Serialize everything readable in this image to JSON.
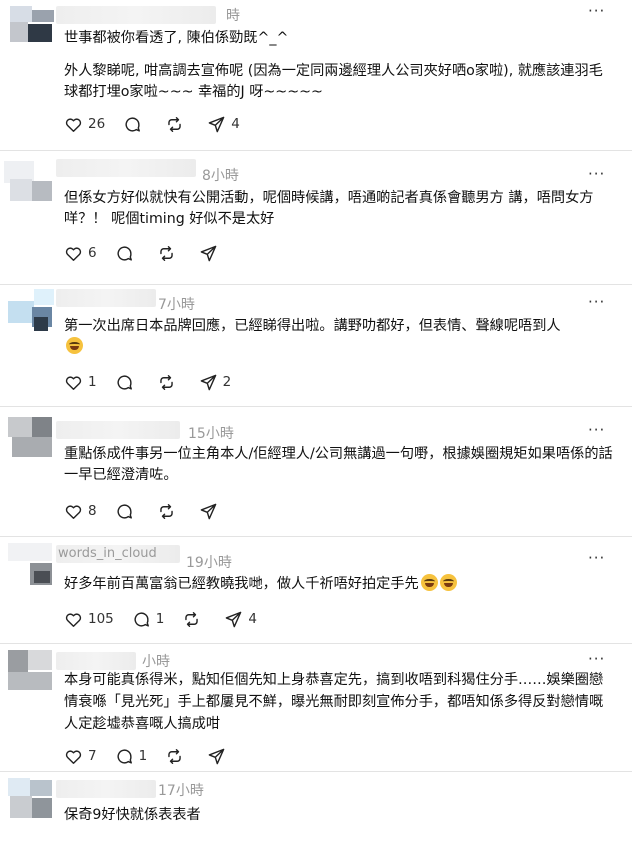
{
  "posts": [
    {
      "time": "時",
      "paragraphs": [
        "世事都被你看透了, 陳伯係勁既^_^",
        "外人黎睇呢, 咁高調去宣佈呢 (因為一定同兩邊經理人公司夾好哂o家啦), 就應該連羽毛球都打埋o家啦~~~ 幸福的J 呀~~~~~"
      ],
      "likes": "26",
      "comments": "",
      "reposts": "",
      "shares": "4"
    },
    {
      "time": "8小時",
      "paragraphs": [
        "但係女方好似就快有公開活動，呢個時候講，唔通啲記者真係會聽男方 講，唔問女方咩？！ 呢個timing 好似不是太好"
      ],
      "likes": "6",
      "comments": "",
      "reposts": "",
      "shares": ""
    },
    {
      "time": "7小時",
      "paragraphs": [
        "第一次出席日本品牌回應，已經睇得出啦。講野叻都好，但表情、聲線呢唔到人"
      ],
      "likes": "1",
      "comments": "",
      "reposts": "",
      "shares": "2"
    },
    {
      "time": "15小時",
      "paragraphs": [
        "重點係成件事另一位主角本人/佢經理人/公司無講過一句嘢，根據娛圈規矩如果唔係的話一早已經澄清咗。"
      ],
      "likes": "8",
      "comments": "",
      "reposts": "",
      "shares": ""
    },
    {
      "time": "19小時",
      "name_fragment": "words_in_cloud",
      "paragraphs": [
        "好多年前百萬富翁已經教曉我哋，做人千祈唔好拍定手先"
      ],
      "likes": "105",
      "comments": "1",
      "reposts": "",
      "shares": "4"
    },
    {
      "time": "小時",
      "paragraphs": [
        "本身可能真係得米，點知佢個先知上身恭喜定先，搞到收唔到科猲住分手……娛樂圈戀情衰喺「見光死」手上都屢見不鮮，曝光無耐即刻宣佈分手，都唔知係多得反對戀情嘅人定趁墟恭喜嘅人搞成咁"
      ],
      "likes": "7",
      "comments": "1",
      "reposts": "",
      "shares": ""
    },
    {
      "time": "17小時",
      "paragraphs": [
        "保奇9好快就係表表者"
      ],
      "likes": "",
      "comments": "",
      "reposts": "",
      "shares": ""
    }
  ],
  "more_label": "···",
  "icons": {
    "like": "heart-icon",
    "comment": "comment-bubble-icon",
    "repost": "repost-icon",
    "share": "send-icon"
  }
}
